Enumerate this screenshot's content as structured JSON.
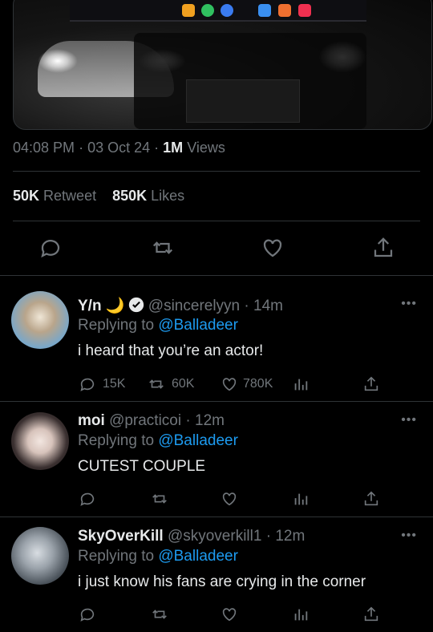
{
  "tweet": {
    "time": "04:08 PM",
    "date": "03 Oct 24",
    "views_count": "1M",
    "views_label": "Views",
    "retweets_count": "50K",
    "retweets_label": "Retweet",
    "likes_count": "850K",
    "likes_label": "Likes",
    "separator": "·"
  },
  "replies": [
    {
      "name": "Y/n",
      "emoji": "🌙",
      "handle": "@sincerelyyn",
      "time": "14m",
      "replying_prefix": "Replying to",
      "replying_to": "@Balladeer",
      "text": "i heard that you’re an actor!",
      "reply_count": "15K",
      "retweet_count": "60K",
      "like_count": "780K"
    },
    {
      "name": "moi",
      "handle": "@practicoi",
      "time": "12m",
      "replying_prefix": "Replying to",
      "replying_to": "@Balladeer",
      "text": "CUTEST COUPLE"
    },
    {
      "name": "SkyOverKill",
      "handle": "@skyoverkill1",
      "time": "12m",
      "replying_prefix": "Replying to",
      "replying_to": "@Balladeer",
      "text": "i just know his fans are crying in the corner"
    }
  ],
  "more_label": "•••",
  "colors": {
    "background": "#000000",
    "text": "#e7e9ea",
    "muted": "#71767b",
    "link": "#1d9bf0",
    "divider": "#2f3336"
  }
}
